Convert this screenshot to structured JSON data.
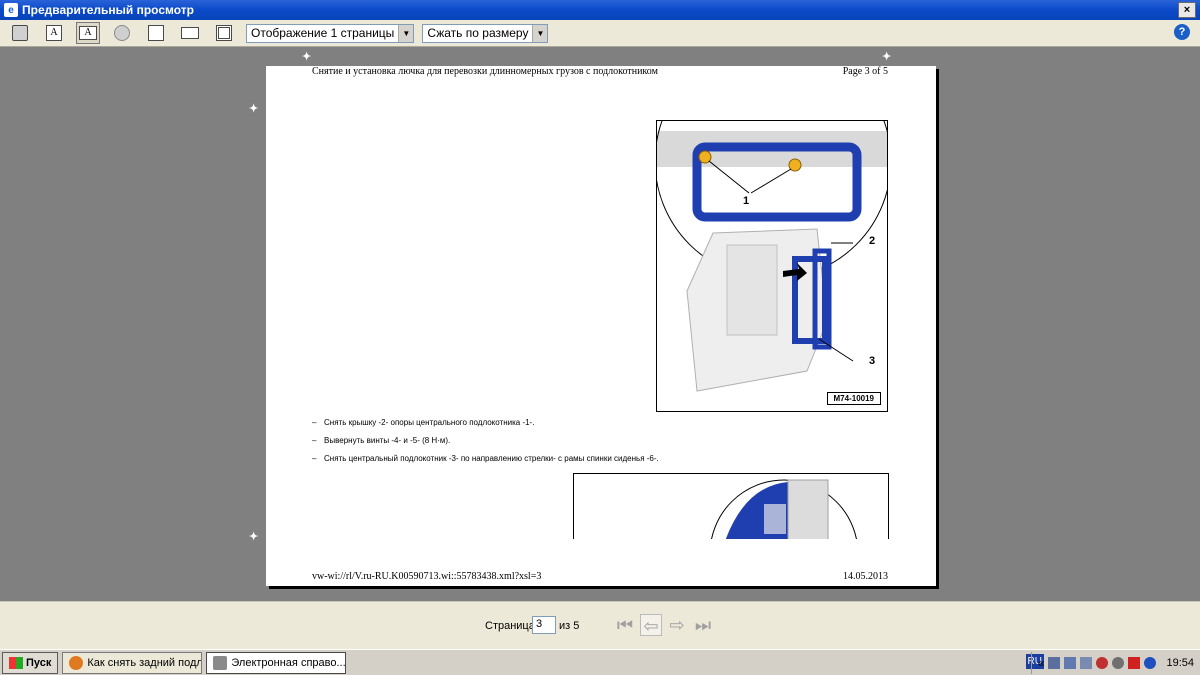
{
  "window": {
    "title": "Предварительный просмотр",
    "close": "×",
    "app_icon": "e"
  },
  "toolbar": {
    "view_mode": "Отображение 1 страницы",
    "zoom_mode": "Сжать по размеру",
    "help": "?"
  },
  "page": {
    "header_left": "Снятие и установка лючка для перевозки длинномерных грузов с подлокотником",
    "header_right": "Page 3 of 5",
    "footer_left": "vw-wi://rl/V.ru-RU.K00590713.wi::55783438.xml?xsl=3",
    "footer_right": "14.05.2013",
    "figure1": {
      "code": "M74-10019",
      "callouts": [
        "1",
        "2",
        "3"
      ]
    },
    "instructions": [
      "Снять крышку -2- опоры центрального подлокотника -1-.",
      "Вывернуть винты -4- и -5- (8 Н·м).",
      "Снять центральный подлокотник -3- по направлению стрелки- с рамы спинки сиденья -6-."
    ],
    "dash": "–"
  },
  "navigation": {
    "page_label": "Страница",
    "page_value": "3",
    "of_label": "из 5"
  },
  "taskbar": {
    "start": "Пуск",
    "tasks": [
      {
        "label": "Как снять задний подл...",
        "icon": "firefox-icon"
      },
      {
        "label": "Электронная справо...",
        "icon": "app-icon"
      }
    ],
    "lang": "RU",
    "tray_chevron": "«",
    "clock": "19:54"
  },
  "colors": {
    "titlebar": "#0a49c9",
    "part_blue": "#1f3fb0",
    "toolbar_bg": "#ece9d8",
    "workspace_bg": "#808080"
  }
}
